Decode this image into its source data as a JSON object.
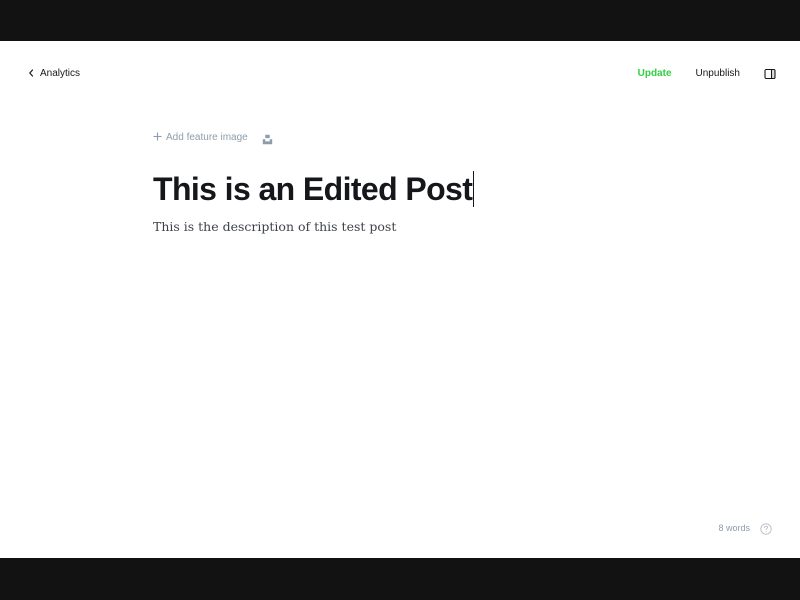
{
  "header": {
    "back_label": "Analytics",
    "update_label": "Update",
    "unpublish_label": "Unpublish"
  },
  "editor": {
    "add_feature_image_label": "Add feature image",
    "title": "This is an Edited Post",
    "excerpt": "This is the description of this test post"
  },
  "footer": {
    "word_count": "8 words"
  },
  "icons": {
    "back": "chevron-left-icon",
    "sidebar_toggle": "sidebar-toggle-icon",
    "add": "plus-icon",
    "unsplash": "unsplash-icon",
    "help": "help-circle-icon"
  },
  "colors": {
    "accent_green": "#30cf43",
    "text_primary": "#15171a",
    "text_muted": "#8e9cac",
    "letterbox": "#121212",
    "canvas": "#ffffff"
  }
}
